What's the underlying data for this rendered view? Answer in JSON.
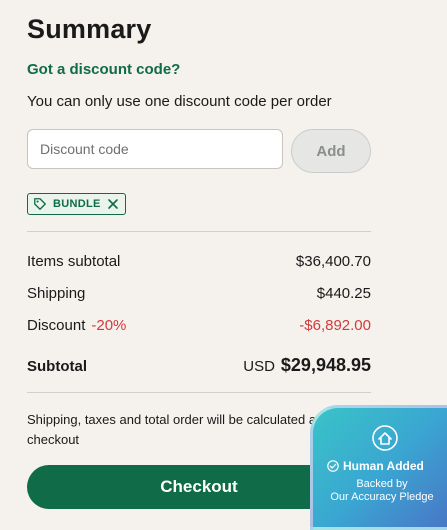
{
  "summary": {
    "title": "Summary",
    "discount_toggle": "Got a discount code?",
    "one_code_note": "You can only use one discount code per order",
    "code_input_placeholder": "Discount code",
    "add_label": "Add",
    "applied_code": "BUNDLE"
  },
  "totals": {
    "items_label": "Items subtotal",
    "items_value": "$36,400.70",
    "shipping_label": "Shipping",
    "shipping_value": "$440.25",
    "discount_label": "Discount",
    "discount_pct": "-20%",
    "discount_value": "-$6,892.00",
    "subtotal_label": "Subtotal",
    "subtotal_currency": "USD",
    "subtotal_value": "$29,948.95"
  },
  "note": "Shipping, taxes and total order will be calculated at checkout",
  "checkout_label": "Checkout",
  "badge": {
    "headline": "Human Added",
    "line1": "Backed by",
    "line2": "Our Accuracy Pledge"
  },
  "colors": {
    "accent": "#0f6b48",
    "negative": "#d13b3b",
    "background": "#f5f1ed"
  },
  "icons": {
    "tag": "tag-icon",
    "remove": "close-icon",
    "badge_home": "house-icon",
    "badge_check": "check-circle-icon"
  }
}
